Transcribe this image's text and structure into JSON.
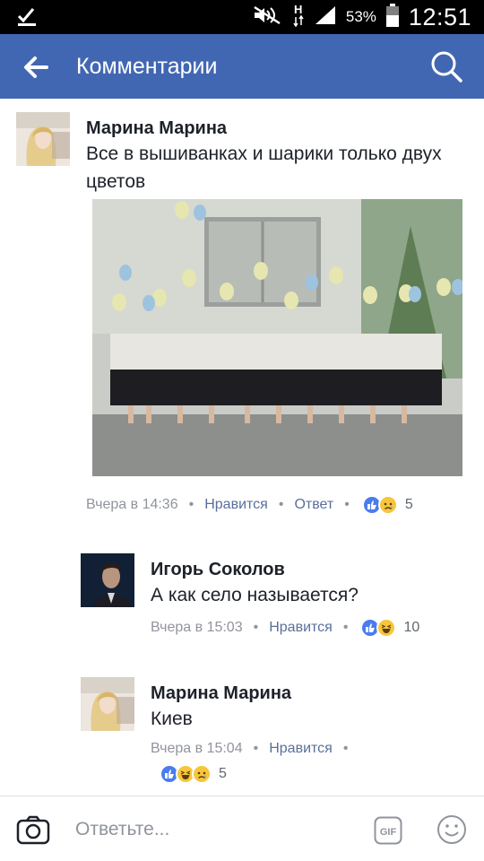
{
  "status_bar": {
    "battery_pct": "53%",
    "time": "12:51",
    "icons": [
      "download-done-icon",
      "mute-icon",
      "network-h-icon",
      "signal-icon",
      "battery-icon"
    ]
  },
  "app_bar": {
    "title": "Комментарии",
    "back_icon": "arrow-left-icon",
    "search_icon": "search-icon",
    "color": "#4267b2"
  },
  "comments": [
    {
      "name": "Марина Марина",
      "text": "Все в вышиванках и шарики только двух цветов",
      "time": "Вчера в 14:36",
      "like": "Нравится",
      "reply": "Ответ",
      "reactions": [
        "like-icon",
        "sad-icon"
      ],
      "reaction_count": "5"
    },
    {
      "name": "Игорь Соколов",
      "text": "А как село называется?",
      "time": "Вчера в 15:03",
      "like": "Нравится",
      "reactions": [
        "like-icon",
        "haha-icon"
      ],
      "reaction_count": "10"
    },
    {
      "name": "Марина Марина",
      "text": "Киев",
      "time": "Вчера в 15:04",
      "like": "Нравится",
      "reactions": [
        "like-icon",
        "haha-icon",
        "sad-icon"
      ],
      "reaction_count": "5"
    }
  ],
  "footer": {
    "placeholder": "Ответьте...",
    "gif_label": "GIF"
  },
  "colors": {
    "facebook_blue": "#4267b2",
    "like_blue": "#4a7cf0",
    "emoji_yellow": "#f7c63c"
  }
}
